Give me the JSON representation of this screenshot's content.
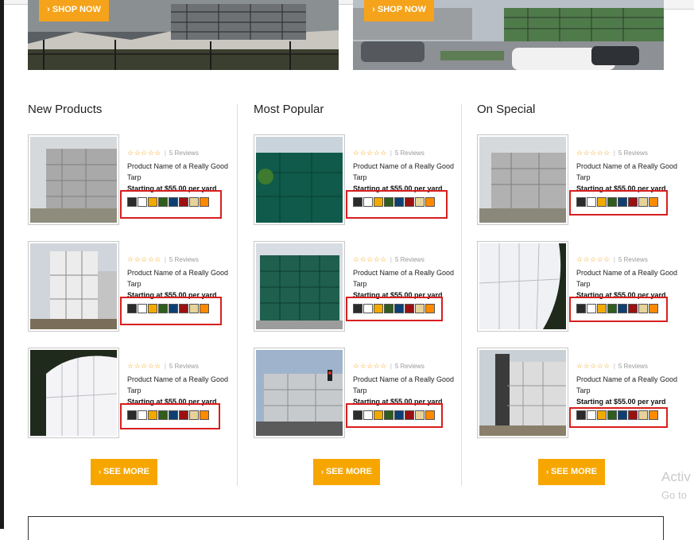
{
  "banners": [
    {
      "button_label": "SHOP NOW"
    },
    {
      "button_label": "SHOP NOW"
    }
  ],
  "columns": [
    {
      "title": "New Products",
      "see_more_label": "SEE MORE",
      "products": [
        {
          "rating_text": "5 Reviews",
          "name": "Product Name of a Really Good Tarp",
          "price": "Starting at $55.00 per yard"
        },
        {
          "rating_text": "5 Reviews",
          "name": "Product Name of a Really Good Tarp",
          "price": "Starting at $55.00 per yard"
        },
        {
          "rating_text": "5 Reviews",
          "name": "Product Name of a Really Good Tarp",
          "price": "Starting at $55.00 per yard"
        }
      ]
    },
    {
      "title": "Most Popular",
      "see_more_label": "SEE MORE",
      "products": [
        {
          "rating_text": "5 Reviews",
          "name": "Product Name of a Really Good Tarp",
          "price": "Starting at $55.00 per yard"
        },
        {
          "rating_text": "5 Reviews",
          "name": "Product Name of a Really Good Tarp",
          "price": "Starting at $55.00 per yard"
        },
        {
          "rating_text": "5 Reviews",
          "name": "Product Name of a Really Good Tarp",
          "price": "Starting at $55.00 per yard"
        }
      ]
    },
    {
      "title": "On Special",
      "see_more_label": "SEE MORE",
      "products": [
        {
          "rating_text": "5 Reviews",
          "name": "Product Name of a Really Good Tarp",
          "price": "Starting at $55.00 per yard"
        },
        {
          "rating_text": "5 Reviews",
          "name": "Product Name of a Really Good Tarp",
          "price": "Starting at $55.00 per yard"
        },
        {
          "rating_text": "5 Reviews",
          "name": "Product Name of a Really Good Tarp",
          "price": "Starting at $55.00 per yard"
        }
      ]
    }
  ],
  "swatch_colors": [
    "#2b2b2b",
    "#ffffff",
    "#f2a900",
    "#2f5d1e",
    "#0e3f73",
    "#9b1111",
    "#e6d39a",
    "#ff8a00"
  ],
  "stars": "☆☆☆☆☆",
  "accent_color": "#f7a600",
  "highlight_color": "#d81e1e",
  "watermark": {
    "line1": "Activ",
    "line2": "Go to"
  }
}
